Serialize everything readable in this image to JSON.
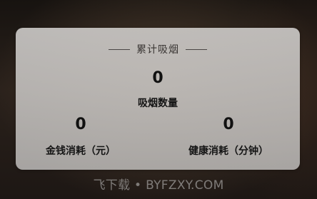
{
  "card": {
    "title": "累计吸烟",
    "smoke_count": {
      "value": "0",
      "label": "吸烟数量"
    },
    "money_spent": {
      "value": "0",
      "label": "金钱消耗（元）"
    },
    "health_spent": {
      "value": "0",
      "label": "健康消耗（分钟）"
    }
  },
  "watermark": "飞下载 • BYFZXY.COM"
}
